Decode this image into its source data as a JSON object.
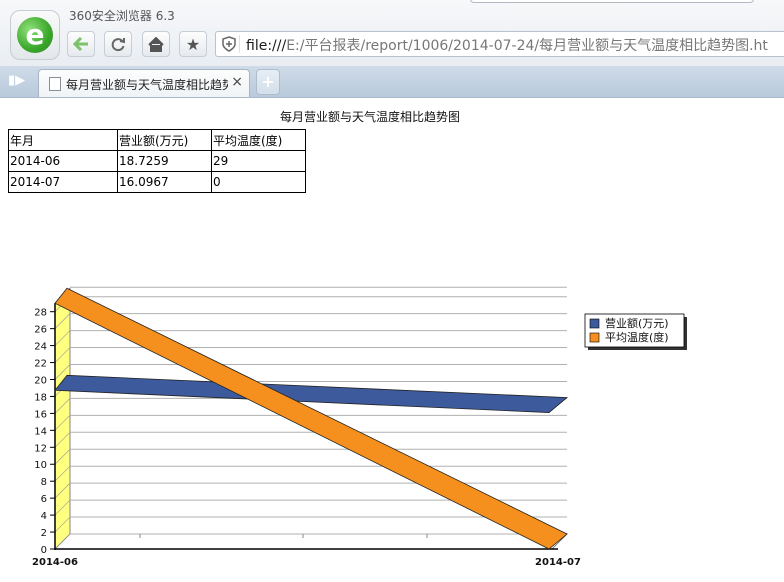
{
  "browser": {
    "app_title": "360安全浏览器 6.3",
    "url_prefix": "file:///",
    "url_rest": "E:/平台报表/report/1006/2014-07-24/每月营业额与天气温度相比趋势图.ht",
    "tab_label": "每月营业额与天气温度相比趋势图",
    "new_tab_symbol": "+",
    "close_symbol": "×",
    "icons": [
      "back-arrow-icon",
      "refresh-icon",
      "home-icon",
      "star-icon",
      "shield-icon",
      "sidebar-toggle-icon",
      "document-icon"
    ]
  },
  "report": {
    "title": "每月营业额与天气温度相比趋势图",
    "table": {
      "headers": [
        "年月",
        "营业额(万元)",
        "平均温度(度)"
      ],
      "rows": [
        [
          "2014-06",
          "18.7259",
          "29"
        ],
        [
          "2014-07",
          "16.0967",
          "0"
        ]
      ]
    }
  },
  "chart_data": {
    "type": "line",
    "categories": [
      "2014-06",
      "2014-07"
    ],
    "series": [
      {
        "name": "营业额(万元)",
        "values": [
          18.7259,
          16.0967
        ],
        "color": "#3d5a9c"
      },
      {
        "name": "平均温度(度)",
        "values": [
          29,
          0
        ],
        "color": "#f5901e"
      }
    ],
    "y_ticks": [
      0,
      2,
      4,
      6,
      8,
      10,
      12,
      14,
      16,
      18,
      20,
      22,
      24,
      26,
      28
    ],
    "ylim": [
      0,
      29
    ],
    "grid": true,
    "three_d": true,
    "legend_position": "right",
    "wall_color": "#ffff80"
  }
}
